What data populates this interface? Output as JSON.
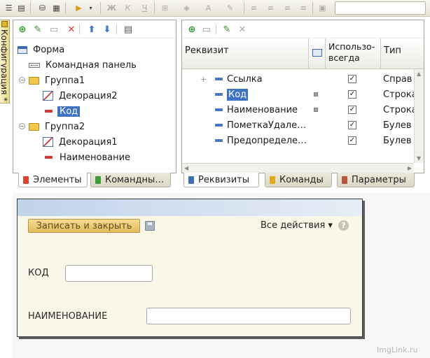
{
  "left_tab": {
    "label": "Конфигурация *"
  },
  "elements_tree": {
    "items": [
      {
        "label": "Форма"
      },
      {
        "label": "Командная панель"
      },
      {
        "label": "Группа1",
        "expander": "−"
      },
      {
        "label": "Декорация2"
      },
      {
        "label": "Код"
      },
      {
        "label": "Группа2",
        "expander": "−"
      },
      {
        "label": "Декорация1"
      },
      {
        "label": "Наименование"
      }
    ],
    "selected": "Код"
  },
  "left_tabs": [
    {
      "label": "Элементы",
      "color": "#d8442f"
    },
    {
      "label": "Командны…",
      "color": "#3f9a3a"
    }
  ],
  "attributes_table": {
    "columns": [
      "Реквизит",
      "Исполь­зовать всегда",
      "Тип"
    ],
    "col2_lines": [
      "Исполь­зо-",
      "всегда"
    ],
    "rows": [
      {
        "name": "Ссылка",
        "expander": "+",
        "checked": true,
        "type": "Справ"
      },
      {
        "name": "Код",
        "marker": true,
        "checked": true,
        "type": "Строка",
        "selected": true
      },
      {
        "name": "Наименование",
        "marker": true,
        "checked": true,
        "type": "Строка"
      },
      {
        "name": "ПометкаУдале…",
        "checked": true,
        "type": "Булев"
      },
      {
        "name": "Предопределе…",
        "checked": true,
        "type": "Булев"
      }
    ],
    "check_mark": "✓"
  },
  "right_tabs": [
    {
      "label": "Реквизиты",
      "color": "#3c6fb8"
    },
    {
      "label": "Команды",
      "color": "#e0a91f"
    },
    {
      "label": "Параметры",
      "color": "#b5563f"
    }
  ],
  "form_preview": {
    "save_button": "Записать и закрыть",
    "all_actions": "Все действия ▾",
    "help": "?",
    "fields": [
      {
        "label": "КОД",
        "value": ""
      },
      {
        "label": "НАИМЕНОВАНИЕ",
        "value": ""
      }
    ]
  },
  "watermark": "ImgLink.ru"
}
